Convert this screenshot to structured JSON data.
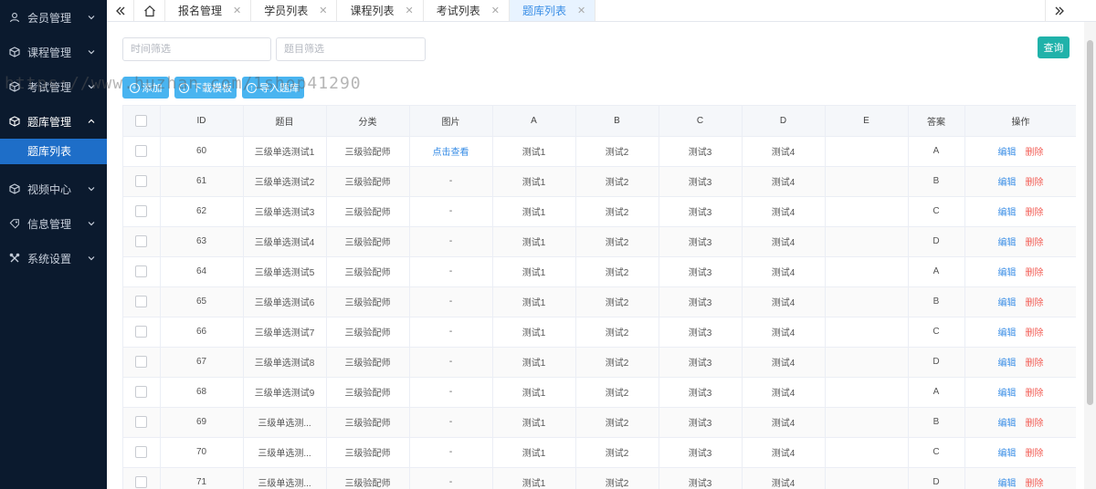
{
  "sidebar": {
    "items": [
      {
        "label": "会员管理",
        "icon": "user-icon"
      },
      {
        "label": "课程管理",
        "icon": "cube-icon"
      },
      {
        "label": "考试管理",
        "icon": "cube-icon"
      },
      {
        "label": "题库管理",
        "icon": "cube-icon",
        "open": true
      },
      {
        "label": "视频中心",
        "icon": "cube-icon"
      },
      {
        "label": "信息管理",
        "icon": "tag-icon"
      },
      {
        "label": "系统设置",
        "icon": "tools-icon"
      }
    ],
    "subitem": {
      "label": "题库列表"
    }
  },
  "tabs": [
    {
      "label": "报名管理"
    },
    {
      "label": "学员列表"
    },
    {
      "label": "课程列表"
    },
    {
      "label": "考试列表"
    },
    {
      "label": "题库列表",
      "active": true
    }
  ],
  "filters": {
    "time_placeholder": "时间筛选",
    "title_placeholder": "题目筛选",
    "query_label": "查询"
  },
  "actions": {
    "add_label": "添加",
    "download_label": "下载模板",
    "import_label": "导入题库"
  },
  "watermark": "https://www.huzhan.com/1shop41290",
  "table": {
    "headers": [
      "ID",
      "题目",
      "分类",
      "图片",
      "A",
      "B",
      "C",
      "D",
      "E",
      "答案",
      "操作"
    ],
    "edit_label": "编辑",
    "delete_label": "删除",
    "rows": [
      {
        "id": "60",
        "title": "三级单选测试1",
        "category": "三级验配师",
        "image": "点击查看",
        "a": "测试1",
        "b": "测试2",
        "c": "测试3",
        "d": "测试4",
        "e": "",
        "answer": "A"
      },
      {
        "id": "61",
        "title": "三级单选测试2",
        "category": "三级验配师",
        "image": "-",
        "a": "测试1",
        "b": "测试2",
        "c": "测试3",
        "d": "测试4",
        "e": "",
        "answer": "B"
      },
      {
        "id": "62",
        "title": "三级单选测试3",
        "category": "三级验配师",
        "image": "-",
        "a": "测试1",
        "b": "测试2",
        "c": "测试3",
        "d": "测试4",
        "e": "",
        "answer": "C"
      },
      {
        "id": "63",
        "title": "三级单选测试4",
        "category": "三级验配师",
        "image": "-",
        "a": "测试1",
        "b": "测试2",
        "c": "测试3",
        "d": "测试4",
        "e": "",
        "answer": "D"
      },
      {
        "id": "64",
        "title": "三级单选测试5",
        "category": "三级验配师",
        "image": "-",
        "a": "测试1",
        "b": "测试2",
        "c": "测试3",
        "d": "测试4",
        "e": "",
        "answer": "A"
      },
      {
        "id": "65",
        "title": "三级单选测试6",
        "category": "三级验配师",
        "image": "-",
        "a": "测试1",
        "b": "测试2",
        "c": "测试3",
        "d": "测试4",
        "e": "",
        "answer": "B"
      },
      {
        "id": "66",
        "title": "三级单选测试7",
        "category": "三级验配师",
        "image": "-",
        "a": "测试1",
        "b": "测试2",
        "c": "测试3",
        "d": "测试4",
        "e": "",
        "answer": "C"
      },
      {
        "id": "67",
        "title": "三级单选测试8",
        "category": "三级验配师",
        "image": "-",
        "a": "测试1",
        "b": "测试2",
        "c": "测试3",
        "d": "测试4",
        "e": "",
        "answer": "D"
      },
      {
        "id": "68",
        "title": "三级单选测试9",
        "category": "三级验配师",
        "image": "-",
        "a": "测试1",
        "b": "测试2",
        "c": "测试3",
        "d": "测试4",
        "e": "",
        "answer": "A"
      },
      {
        "id": "69",
        "title": "三级单选测...",
        "category": "三级验配师",
        "image": "-",
        "a": "测试1",
        "b": "测试2",
        "c": "测试3",
        "d": "测试4",
        "e": "",
        "answer": "B"
      },
      {
        "id": "70",
        "title": "三级单选测...",
        "category": "三级验配师",
        "image": "-",
        "a": "测试1",
        "b": "测试2",
        "c": "测试3",
        "d": "测试4",
        "e": "",
        "answer": "C"
      },
      {
        "id": "71",
        "title": "三级单选测...",
        "category": "三级验配师",
        "image": "-",
        "a": "测试1",
        "b": "测试2",
        "c": "测试3",
        "d": "测试4",
        "e": "",
        "answer": "D"
      }
    ]
  }
}
